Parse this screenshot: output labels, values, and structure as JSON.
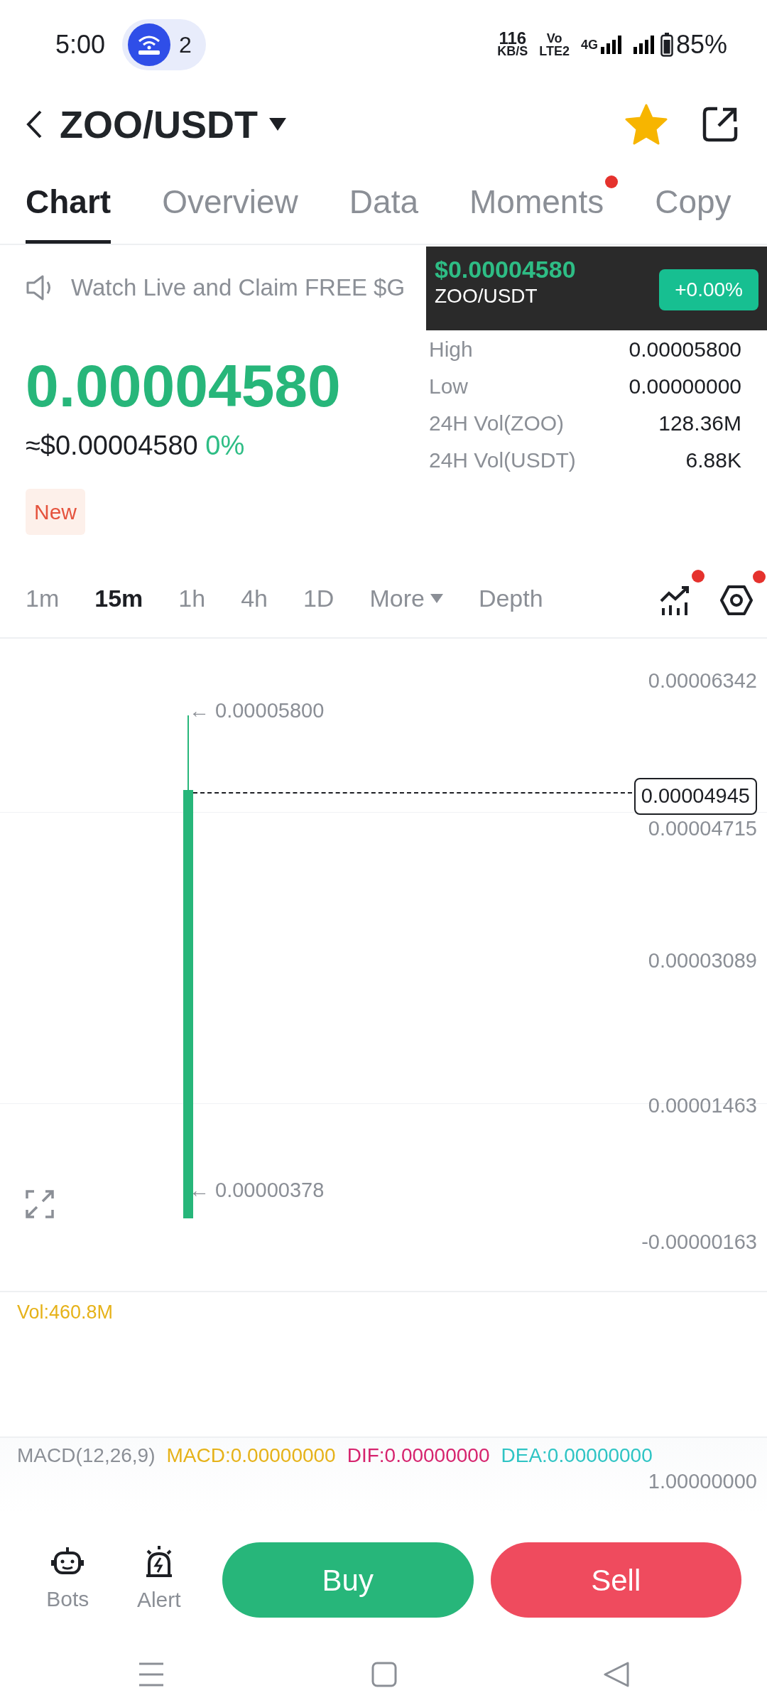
{
  "status_bar": {
    "time": "5:00",
    "notification_count": "2",
    "speed_value": "116",
    "speed_unit": "KB/S",
    "volte_top": "Vo",
    "volte_bottom": "LTE2",
    "network": "4G",
    "battery": "85%"
  },
  "header": {
    "pair": "ZOO/USDT",
    "favorite": true
  },
  "tabs": [
    {
      "label": "Chart",
      "selected": true,
      "dot": false
    },
    {
      "label": "Overview",
      "selected": false,
      "dot": false
    },
    {
      "label": "Data",
      "selected": false,
      "dot": false
    },
    {
      "label": "Moments",
      "selected": false,
      "dot": true
    },
    {
      "label": "Copy",
      "selected": false,
      "dot": false
    }
  ],
  "banner": {
    "text": "Watch Live and Claim FREE $G"
  },
  "ticker_popup": {
    "price": "$0.00004580",
    "pair": "ZOO/USDT",
    "change": "+0.00%"
  },
  "price": {
    "last": "0.00004580",
    "usd": "≈$0.00004580",
    "change": "0%",
    "tag": "New"
  },
  "stats": [
    {
      "label": "High",
      "value": "0.00005800"
    },
    {
      "label": "Low",
      "value": "0.00000000"
    },
    {
      "label": "24H Vol(ZOO)",
      "value": "128.36M"
    },
    {
      "label": "24H Vol(USDT)",
      "value": "6.88K"
    }
  ],
  "intervals": [
    {
      "label": "1m",
      "selected": false,
      "kind": "interval"
    },
    {
      "label": "15m",
      "selected": true,
      "kind": "interval"
    },
    {
      "label": "1h",
      "selected": false,
      "kind": "interval"
    },
    {
      "label": "4h",
      "selected": false,
      "kind": "interval"
    },
    {
      "label": "1D",
      "selected": false,
      "kind": "interval"
    },
    {
      "label": "More",
      "selected": false,
      "kind": "dropdown"
    },
    {
      "label": "Depth",
      "selected": false,
      "kind": "interval"
    }
  ],
  "chart_tools": [
    {
      "kind": "indicators",
      "dot": true
    },
    {
      "kind": "settings",
      "dot": true
    }
  ],
  "chart": {
    "y_axis_labels": [
      "0.00006342",
      "0.00004715",
      "0.00003089",
      "0.00001463",
      "-0.00000163"
    ],
    "high_marker": "← 0.00005800",
    "low_marker": "← 0.00000378",
    "last_price_label": "0.00004945"
  },
  "volume": {
    "label": "Vol:460.8M"
  },
  "macd": {
    "name": "MACD(12,26,9)",
    "macd": "MACD:0.00000000",
    "dif": "DIF:0.00000000",
    "dea": "DEA:0.00000000",
    "axis_label": "1.00000000"
  },
  "bottom_bar": {
    "tools": [
      {
        "kind": "bots",
        "label": "Bots"
      },
      {
        "kind": "alert",
        "label": "Alert"
      }
    ],
    "buy": "Buy",
    "sell": "Sell"
  }
}
